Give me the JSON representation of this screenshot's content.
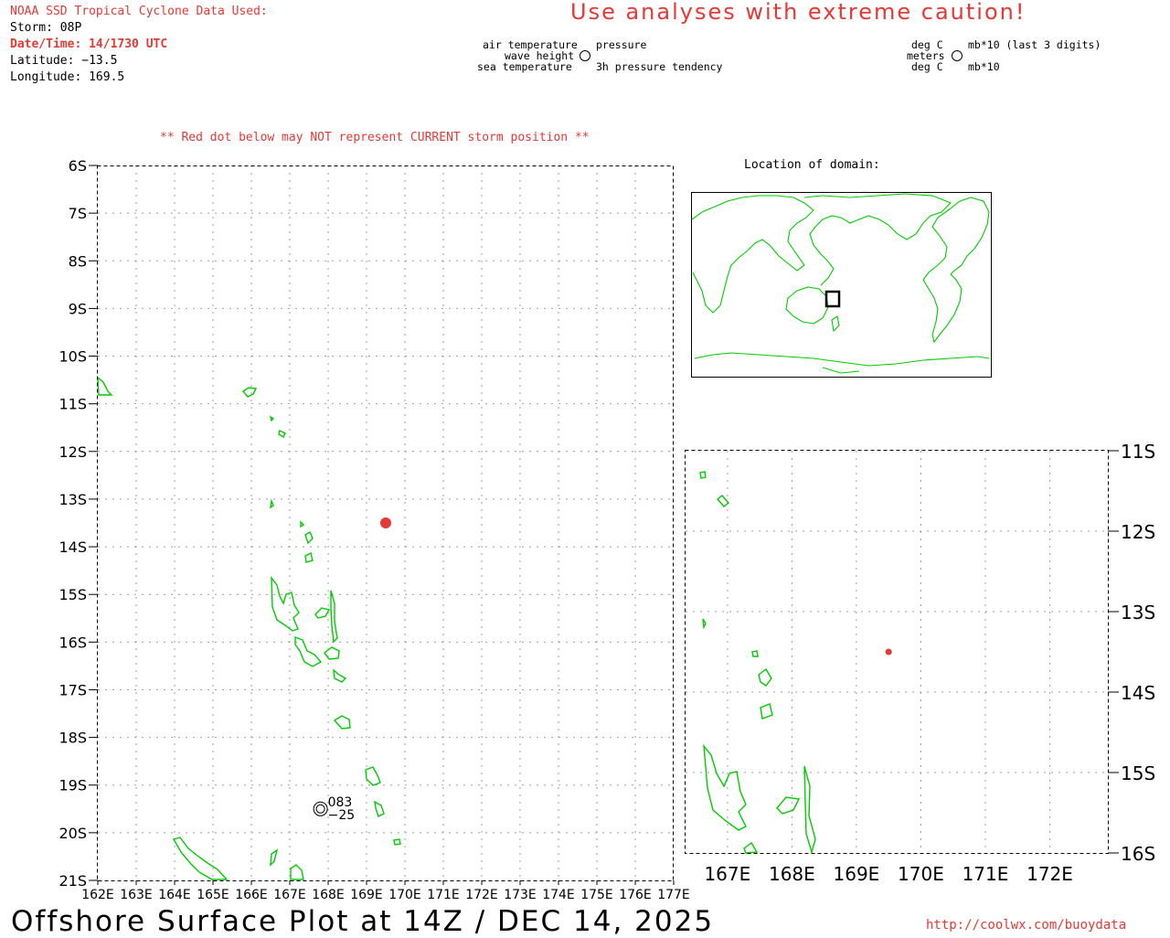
{
  "header": {
    "source_title": "NOAA SSD Tropical Cyclone Data Used:",
    "storm": "Storm: 08P",
    "datetime": "Date/Time: 14/1730 UTC",
    "latitude": "Latitude: −13.5",
    "longitude": "Longitude: 169.5"
  },
  "caution": "Use analyses with extreme caution!",
  "legend": {
    "left": {
      "air_temperature": "air temperature",
      "wave_height": "wave height",
      "sea_temperature": "sea temperature",
      "pressure": "pressure",
      "pressure_tendency": "3h pressure tendency"
    },
    "right": {
      "deg_c_top": "deg C",
      "meters": "meters",
      "deg_c_bottom": "deg C",
      "mb_last3": "mb*10 (last 3 digits)",
      "mb10": "mb*10"
    }
  },
  "warning": "** Red dot below may NOT represent CURRENT storm position **",
  "locator_title": "Location of domain:",
  "main_map": {
    "lat_labels": [
      "6S",
      "7S",
      "8S",
      "9S",
      "10S",
      "11S",
      "12S",
      "13S",
      "14S",
      "15S",
      "16S",
      "17S",
      "18S",
      "19S",
      "20S",
      "21S"
    ],
    "lon_labels": [
      "162E",
      "163E",
      "164E",
      "165E",
      "166E",
      "167E",
      "168E",
      "169E",
      "170E",
      "171E",
      "172E",
      "173E",
      "174E",
      "175E",
      "176E",
      "177E"
    ],
    "storm_position": {
      "lat": -13.5,
      "lon": 169.5
    },
    "station": {
      "lat": -19.5,
      "lon": 167.8,
      "pressure": "083",
      "tendency": "−25"
    }
  },
  "inset_map": {
    "lat_labels": [
      "11S",
      "12S",
      "13S",
      "14S",
      "15S",
      "16S"
    ],
    "lon_labels": [
      "167E",
      "168E",
      "169E",
      "170E",
      "171E",
      "172E"
    ],
    "storm_position": {
      "lat": -13.5,
      "lon": 169.5
    }
  },
  "footer": {
    "title": "Offshore Surface Plot at 14Z / DEC 14, 2025",
    "url": "http://coolwx.com/buoydata"
  },
  "colors": {
    "accent_red": "#e53935",
    "coastline": "#00cc00",
    "grid": "#9e9e9e"
  }
}
